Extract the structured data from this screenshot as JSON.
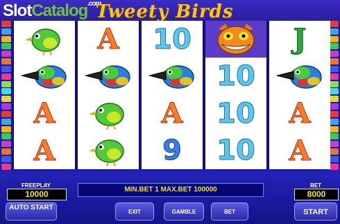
{
  "watermark": {
    "part1": "Slot",
    "part2": "Catalog",
    "suffix": ".com"
  },
  "game_title": "Tweety Birds",
  "reels": [
    [
      "green-bird",
      "toucan",
      "A",
      "A"
    ],
    [
      "A",
      "toucan",
      "green-bird",
      "green-bird"
    ],
    [
      "10",
      "toucan",
      "A",
      "9"
    ],
    [
      "cat",
      "10",
      "10",
      "10"
    ],
    [
      "J",
      "toucan",
      "A",
      "A"
    ]
  ],
  "colors": {
    "background": "#1a1aa8",
    "accent": "#f5e21e"
  },
  "panel": {
    "freeplay_label": "FREEPLAY",
    "freeplay_value": "10000",
    "bet_label": "BET",
    "bet_value": "8000",
    "info": "MIN.BET 1 MAX.BET 100000"
  },
  "buttons": {
    "auto_start": "AUTO START",
    "exit": "EXIT",
    "gamble": "GAMBLE",
    "bet": "BET",
    "start": "START"
  }
}
